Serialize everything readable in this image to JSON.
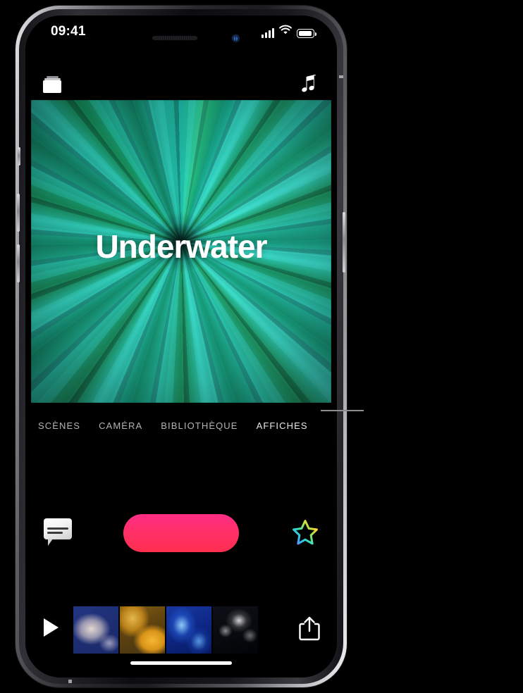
{
  "device": {
    "status_bar": {
      "time": "09:41",
      "signal_icon": "cellular-signal-icon",
      "wifi_icon": "wifi-icon",
      "battery_icon": "battery-full-icon"
    },
    "hardware": {
      "speaker_icon": "speaker-grille",
      "camera_icon": "front-camera-lens",
      "home_indicator": "home-indicator-bar",
      "buttons": [
        "mute-switch",
        "volume-up-button",
        "volume-down-button",
        "power-button"
      ]
    }
  },
  "app": {
    "toolbar": {
      "projects_icon": "projects-stack-icon",
      "music_icon": "music-note-icon"
    },
    "poster": {
      "title": "Underwater",
      "art_name": "teal-petal-burst-artwork"
    },
    "tabs": [
      {
        "label": "SCÈNES",
        "name": "tab-scenes",
        "active": false
      },
      {
        "label": "CAMÉRA",
        "name": "tab-camera",
        "active": false
      },
      {
        "label": "BIBLIOTHÈQUE",
        "name": "tab-library",
        "active": false
      },
      {
        "label": "AFFICHES",
        "name": "tab-posters",
        "active": true
      }
    ],
    "controls": {
      "teleprompter_icon": "speech-bubble-icon",
      "record_button_label": "",
      "record_button_name": "record-button",
      "effects_icon": "rainbow-star-icon"
    },
    "timeline": {
      "play_icon": "play-button-icon",
      "share_icon": "share-icon",
      "clips": [
        {
          "name": "clip-thumbnail-1",
          "description": "pale jellyfish on blue"
        },
        {
          "name": "clip-thumbnail-2",
          "description": "yellow jellyfish"
        },
        {
          "name": "clip-thumbnail-3",
          "description": "blue jellyfish"
        },
        {
          "name": "clip-thumbnail-4",
          "description": "white jellyfish on black"
        }
      ]
    }
  },
  "annotation": {
    "leader_line_name": "callout-leader-line",
    "points_to": "AFFICHES"
  },
  "colors": {
    "record_pink": "#FF2E86",
    "record_red": "#FF2F4F",
    "tab_inactive": "#B4B4B8",
    "tab_active": "#E9E9EC",
    "screen_background": "#000000",
    "poster_teal": "#1FBFAE"
  }
}
